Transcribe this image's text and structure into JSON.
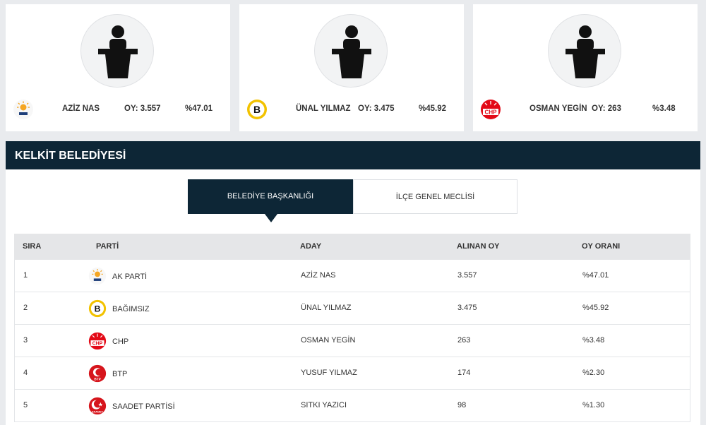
{
  "top_cards": [
    {
      "logo": "akparti-logo",
      "name": "AZİZ NAS",
      "votes": "OY: 3.557",
      "pct": "%47.01"
    },
    {
      "logo": "bagimsiz-logo",
      "name": "ÜNAL YILMAZ",
      "votes": "OY: 3.475",
      "pct": "%45.92"
    },
    {
      "logo": "chp-logo",
      "name": "OSMAN YEGİN",
      "votes": "OY: 263",
      "pct": "%3.48"
    }
  ],
  "panel": {
    "title": "KELKİT BELEDİYESİ"
  },
  "tabs": {
    "active": "BELEDİYE BAŞKANLIĞI",
    "inactive": "İLÇE GENEL MECLİSİ"
  },
  "table": {
    "headers": {
      "sira": "SIRA",
      "parti": "PARTİ",
      "aday": "ADAY",
      "oy": "ALINAN OY",
      "oran": "OY ORANI"
    },
    "rows": [
      {
        "sira": "1",
        "logo": "akparti-logo",
        "parti": "AK PARTİ",
        "aday": "AZİZ NAS",
        "oy": "3.557",
        "oran": "%47.01"
      },
      {
        "sira": "2",
        "logo": "bagimsiz-logo",
        "parti": "BAĞIMSIZ",
        "aday": "ÜNAL YILMAZ",
        "oy": "3.475",
        "oran": "%45.92"
      },
      {
        "sira": "3",
        "logo": "chp-logo",
        "parti": "CHP",
        "aday": "OSMAN YEGİN",
        "oy": "263",
        "oran": "%3.48"
      },
      {
        "sira": "4",
        "logo": "btp-logo",
        "parti": "BTP",
        "aday": "YUSUF YILMAZ",
        "oy": "174",
        "oran": "%2.30"
      },
      {
        "sira": "5",
        "logo": "saadet-logo",
        "parti": "SAADET PARTİSİ",
        "aday": "SITKI YAZICI",
        "oy": "98",
        "oran": "%1.30"
      }
    ]
  },
  "colors": {
    "header_bg": "#0d2636",
    "akparti": "#f5a623",
    "bagimsiz": "#f2c200",
    "chp": "#e30a17",
    "btp": "#d6151c",
    "saadet": "#d6151c"
  }
}
